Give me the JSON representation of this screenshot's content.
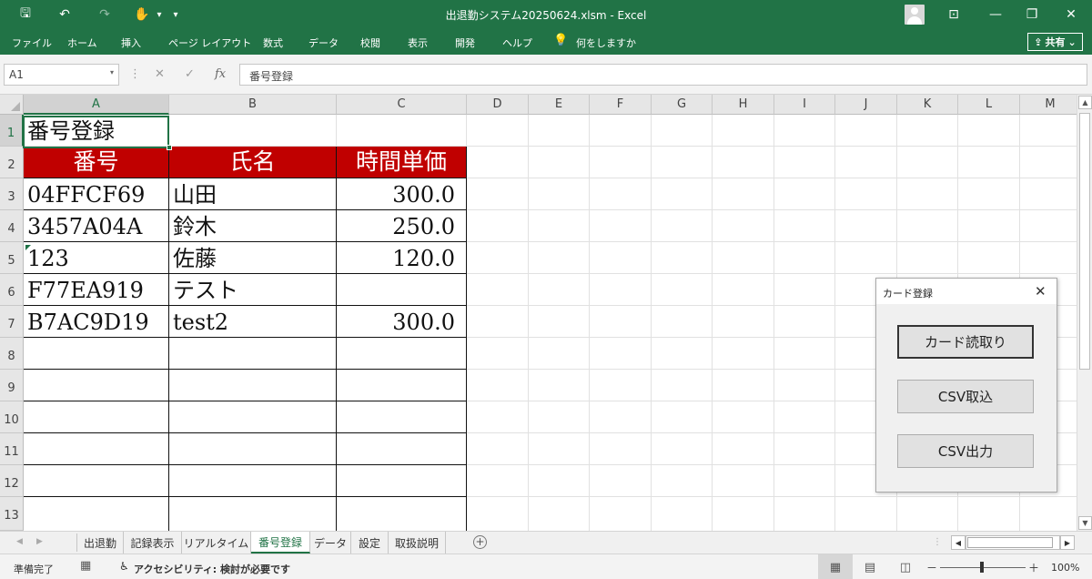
{
  "window": {
    "title": "出退勤システム20250624.xlsm  -  Excel",
    "minimize": "—",
    "restore": "❐",
    "close": "✕",
    "ribbon_display": "⊡"
  },
  "quick_access": {
    "save": "🖫",
    "undo": "↶",
    "redo": "↷",
    "touch": "✋",
    "customize": "▾"
  },
  "ribbon": {
    "tabs": [
      "ファイル",
      "ホーム",
      "挿入",
      "ページ レイアウト",
      "数式",
      "データ",
      "校閲",
      "表示",
      "開発",
      "ヘルプ"
    ],
    "tell_me_icon": "💡",
    "tell_me": "何をしますか",
    "share_icon": "⇪",
    "share": "共有",
    "share_caret": "⌄"
  },
  "formula_bar": {
    "name_box": "A1",
    "name_box_caret": "▾",
    "more_dots": "⋮",
    "cancel": "✕",
    "enter": "✓",
    "fx": "fx",
    "content": "番号登録"
  },
  "sheet": {
    "columns": [
      "A",
      "B",
      "C",
      "D",
      "E",
      "F",
      "G",
      "H",
      "I",
      "J",
      "K",
      "L",
      "M"
    ],
    "rows": [
      "1",
      "2",
      "3",
      "4",
      "5",
      "6",
      "7",
      "8",
      "9",
      "10",
      "11",
      "12",
      "13"
    ],
    "title_cell": "番号登録",
    "headers": [
      "番号",
      "氏名",
      "時間単価"
    ],
    "records": [
      {
        "id": "04FFCF69",
        "name": "山田",
        "rate": "300.0"
      },
      {
        "id": "3457A04A",
        "name": "鈴木",
        "rate": "250.0"
      },
      {
        "id": "123",
        "name": "佐藤",
        "rate": "120.0"
      },
      {
        "id": "F77EA919",
        "name": "テスト",
        "rate": ""
      },
      {
        "id": "B7AC9D19",
        "name": "test2",
        "rate": "300.0"
      }
    ],
    "header_color": "#c00000",
    "accent_color": "#217346"
  },
  "scrollbars": {
    "up": "▲",
    "down": "▼",
    "left": "◀",
    "right": "▶"
  },
  "sheet_tabs": {
    "nav_prev": "◀",
    "nav_next": "▶",
    "tabs": [
      "出退勤",
      "記録表示",
      "リアルタイム",
      "番号登録",
      "データ",
      "設定",
      "取扱説明"
    ],
    "active": "番号登録",
    "add": "+",
    "split": "⋮"
  },
  "status_bar": {
    "ready": "準備完了",
    "macro_icon": "▦",
    "accessibility_icon": "♿",
    "accessibility": "アクセシビリティ: 検討が必要です",
    "view_normal": "▦",
    "view_page_layout": "▤",
    "view_page_break": "◫",
    "zoom_minus": "－",
    "zoom_plus": "＋",
    "zoom_level": "100%"
  },
  "dialog": {
    "title": "カード登録",
    "close": "✕",
    "buttons": [
      "カード読取り",
      "CSV取込",
      "CSV出力"
    ]
  }
}
